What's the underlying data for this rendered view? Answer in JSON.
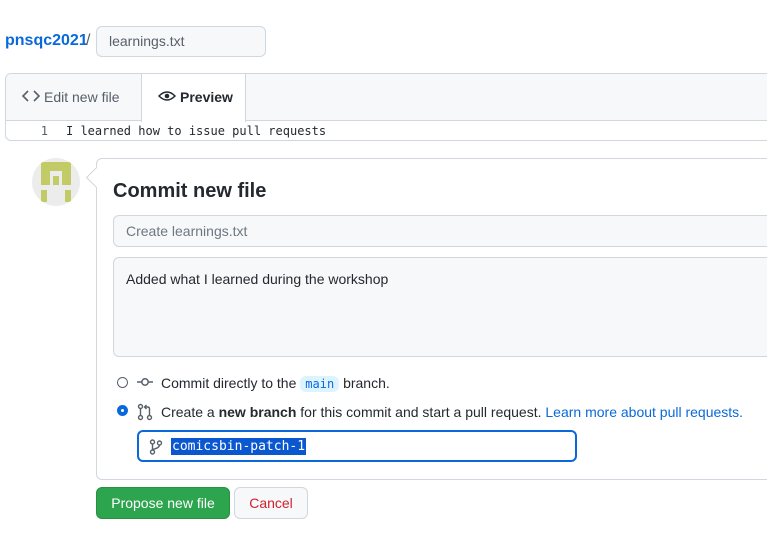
{
  "breadcrumb": {
    "repo": "pnsqc2021",
    "separator": "/",
    "filename": "learnings.txt"
  },
  "editor": {
    "tabs": [
      {
        "label": "Edit new file",
        "icon": "code-icon",
        "active": false
      },
      {
        "label": "Preview",
        "icon": "eye-icon",
        "active": true
      }
    ],
    "lines": [
      {
        "number": "1",
        "text": "I learned how to issue pull requests"
      }
    ]
  },
  "commit": {
    "title": "Commit new file",
    "summary_placeholder": "Create learnings.txt",
    "description": "Added what I learned during the workshop",
    "options": {
      "direct": {
        "text_before": "Commit directly to the",
        "branch": "main",
        "text_after": "branch.",
        "selected": false,
        "icon": "commit-icon"
      },
      "new_branch": {
        "text_before": "Create a",
        "bold": "new branch",
        "text_after": "for this commit and start a pull request.",
        "link": "Learn more about pull requests.",
        "selected": true,
        "icon": "pull-request-icon"
      }
    },
    "branch_name": "comicsbin-patch-1",
    "branch_icon": "git-branch-icon"
  },
  "buttons": {
    "propose": "Propose new file",
    "cancel": "Cancel"
  },
  "colors": {
    "link": "#0969da",
    "primary_button": "#2da44e",
    "danger_text": "#cf222e"
  }
}
